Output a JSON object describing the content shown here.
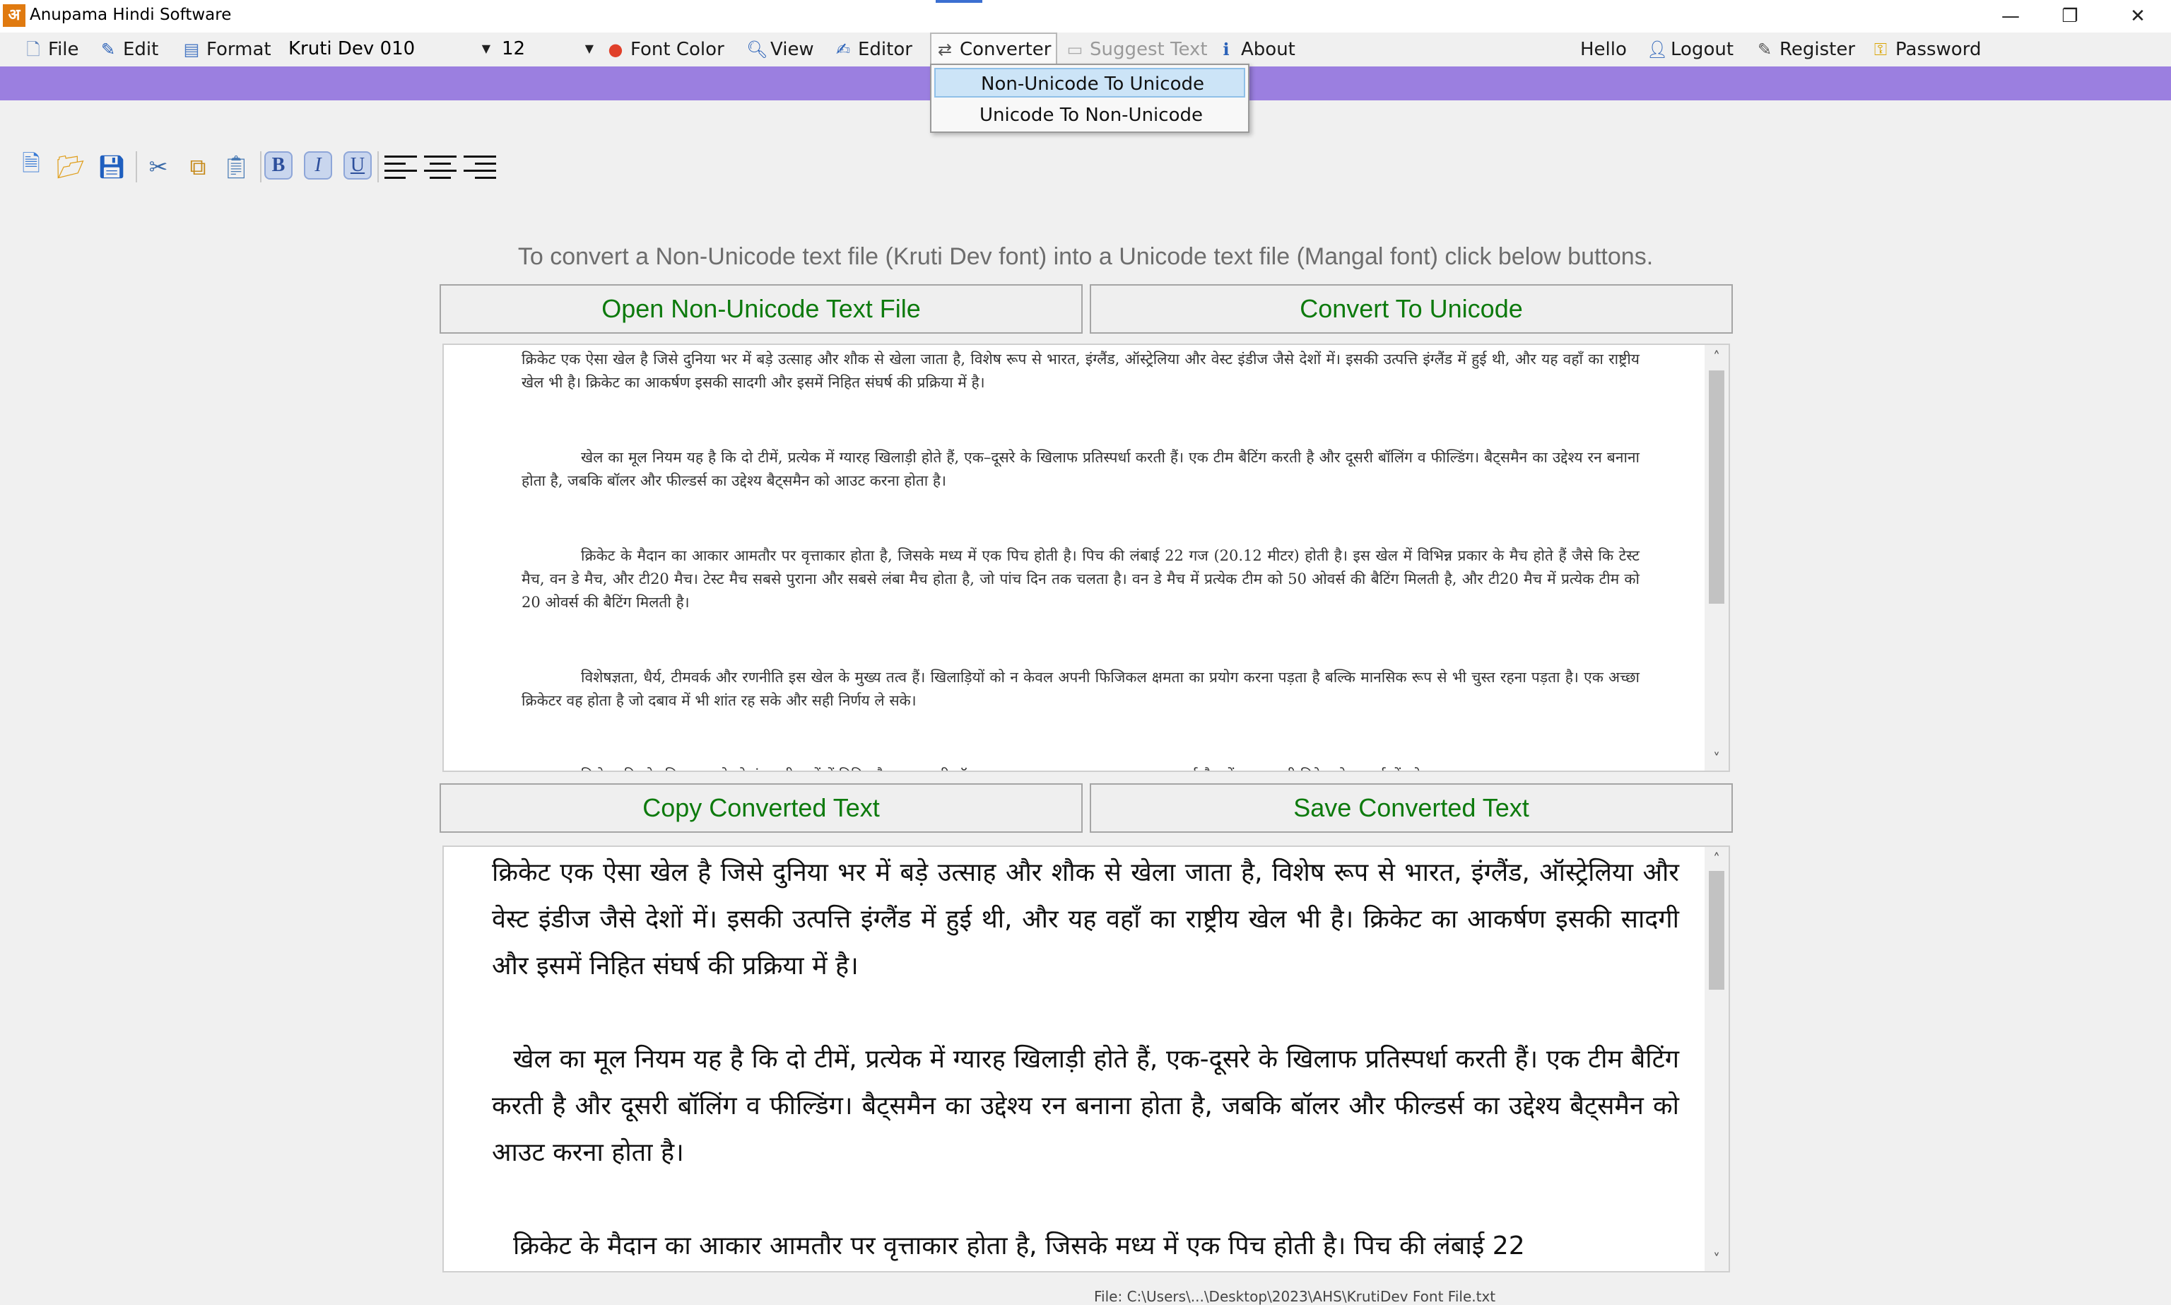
{
  "window": {
    "icon_glyph": "अ",
    "title": "Anupama Hindi Software",
    "minimize_glyph": "—",
    "maximize_glyph": "❐",
    "close_glyph": "✕"
  },
  "menubar": {
    "file": "File",
    "edit": "Edit",
    "format": "Format",
    "font_name": "Kruti Dev 010",
    "font_size": "12",
    "font_color": "Font Color",
    "view": "View",
    "editor": "Editor",
    "converter": "Converter",
    "suggest_text": "Suggest Text",
    "about": "About",
    "hello": "Hello",
    "logout": "Logout",
    "register": "Register",
    "password": "Password"
  },
  "converter_menu": {
    "items": [
      "Non-Unicode To Unicode",
      "Unicode To Non-Unicode"
    ]
  },
  "toolbar": {
    "icons": [
      "new-file-icon",
      "open-folder-icon",
      "save-icon",
      "cut-icon",
      "copy-icon",
      "paste-icon",
      "bold-icon",
      "italic-icon",
      "underline-icon",
      "align-left-icon",
      "align-center-icon",
      "align-right-icon"
    ],
    "bold_label": "B",
    "italic_label": "I",
    "underline_label": "U"
  },
  "instruction": "To convert a Non-Unicode text file (Kruti Dev font) into a Unicode text file (Mangal font) click below buttons.",
  "buttons": {
    "open": "Open Non-Unicode Text File",
    "convert": "Convert To Unicode",
    "copy": "Copy Converted Text",
    "save": "Save Converted Text"
  },
  "source_text": {
    "p1": "क्रिकेट एक ऐसा खेल है जिसे दुनिया भर में बड़े उत्साह और शौक से खेला जाता है, विशेष रूप से भारत, इंग्लैंड, ऑस्ट्रेलिया और वेस्ट इंडीज जैसे देशों में। इसकी उत्पत्ति इंग्लैंड में हुई थी, और यह वहाँ का राष्ट्रीय खेल भी है। क्रिकेट का आकर्षण इसकी सादगी और इसमें निहित संघर्ष की प्रक्रिया में है।",
    "p2": "खेल का मूल नियम यह है कि दो टीमें, प्रत्येक में ग्यारह खिलाड़ी होते हैं, एक–दूसरे के खिलाफ प्रतिस्पर्धा करती हैं। एक टीम बैटिंग करती है और दूसरी बॉलिंग व फील्डिंग। बैट्समैन का उद्देश्य रन बनाना होता है, जबकि बॉलर और फील्डर्स का उद्देश्य बैट्समैन को आउट करना होता है।",
    "p3": "क्रिकेट के मैदान का आकार आमतौर पर वृत्ताकार होता है, जिसके मध्य में एक पिच होती है। पिच की लंबाई 22 गज (20.12 मीटर) होती है। इस खेल में विभिन्न प्रकार के मैच होते हैं जैसे कि टेस्ट मैच, वन डे मैच, और टी20 मैच। टेस्ट मैच सबसे पुराना और सबसे लंबा मैच होता है, जो पांच दिन तक चलता है। वन डे मैच में प्रत्येक टीम को 50 ओवर्स की बैटिंग मिलती है, और टी20 मैच में प्रत्येक टीम को 20 ओवर्स की बैटिंग मिलती है।",
    "p4": "विशेषज्ञता, धैर्य, टीमवर्क और रणनीति इस खेल के मुख्य तत्व हैं। खिलाड़ियों को न केवल अपनी फिजिकल क्षमता का प्रयोग करना पड़ता है बल्कि मानसिक रूप से भी चुस्त रहना पड़ता है। एक अच्छा क्रिकेटर वह होता है जो दबाव में भी शांत रह सके और सही निर्णय ले सके।",
    "p5": "क्रिकेट की लोकप्रियता इसके रोमांचकारी पलों में निहित है। एक अच्छी बॉल पर एक शानदार छक्का या एक महत्वपूर्ण मैच में एक जरूरी विकेट लेना, दर्शकों को"
  },
  "result_text": {
    "p1": "क्रिकेट एक ऐसा खेल है जिसे दुनिया भर में बड़े उत्साह और शौक से खेला जाता है, विशेष रूप से भारत, इंग्लैंड, ऑस्ट्रेलिया और वेस्ट इंडीज जैसे देशों में। इसकी उत्पत्ति इंग्लैंड में हुई थी, और यह वहाँ का राष्ट्रीय खेल भी है। क्रिकेट का आकर्षण इसकी सादगी और इसमें निहित संघर्ष की प्रक्रिया में है।",
    "p2": "खेल का मूल नियम यह है कि दो टीमें, प्रत्येक में ग्यारह खिलाड़ी होते हैं, एक-दूसरे के खिलाफ प्रतिस्पर्धा करती हैं। एक टीम बैटिंग करती है और दूसरी बॉलिंग व फील्डिंग। बैट्समैन का उद्देश्य रन बनाना होता है, जबकि बॉलर और फील्डर्स का उद्देश्य बैट्समैन को आउट करना होता है।",
    "p3": "क्रिकेट के मैदान का आकार आमतौर पर वृत्ताकार होता है, जिसके मध्य में एक पिच होती है। पिच की लंबाई 22"
  },
  "status_path": "File: C:\\Users\\...\\Desktop\\2023\\AHS\\KrutiDev Font File.txt"
}
